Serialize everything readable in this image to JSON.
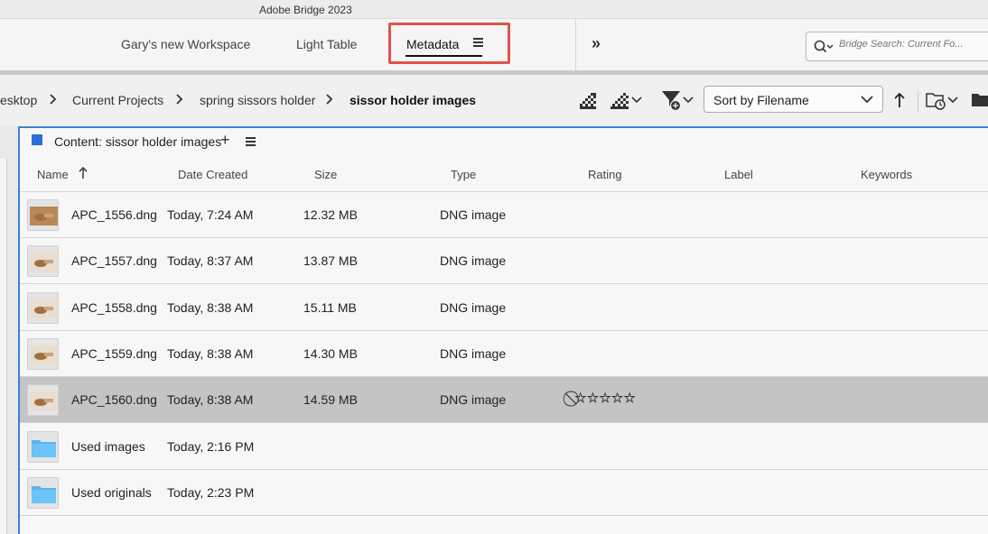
{
  "app": {
    "title": "Adobe Bridge 2023"
  },
  "workspace": {
    "tabs": [
      {
        "label": "Gary's new Workspace"
      },
      {
        "label": "Light Table"
      },
      {
        "label": "Metadata"
      }
    ],
    "more_label": "»",
    "search_placeholder": "Bridge Search: Current Fo..."
  },
  "path": {
    "crumbs": [
      "esktop",
      "Current Projects",
      "spring sissors holder",
      "sissor holder images"
    ],
    "sort_label": "Sort by Filename"
  },
  "content": {
    "title": "Content: sissor holder images",
    "columns": [
      "Name",
      "Date Created",
      "Size",
      "Type",
      "Rating",
      "Label",
      "Keywords"
    ],
    "rows": [
      {
        "name": "APC_1556.dng",
        "date": "Today, 7:24 AM",
        "size": "12.32 MB",
        "type": "DNG image",
        "thumb": "image"
      },
      {
        "name": "APC_1557.dng",
        "date": "Today, 8:37 AM",
        "size": "13.87 MB",
        "type": "DNG image",
        "thumb": "image"
      },
      {
        "name": "APC_1558.dng",
        "date": "Today, 8:38 AM",
        "size": "15.11 MB",
        "type": "DNG image",
        "thumb": "image"
      },
      {
        "name": "APC_1559.dng",
        "date": "Today, 8:38 AM",
        "size": "14.30 MB",
        "type": "DNG image",
        "thumb": "image"
      },
      {
        "name": "APC_1560.dng",
        "date": "Today, 8:38 AM",
        "size": "14.59 MB",
        "type": "DNG image",
        "thumb": "image",
        "rating": "⃠☆☆☆☆☆",
        "selected": true
      },
      {
        "name": "Used images",
        "date": "Today, 2:16 PM",
        "size": "",
        "type": "",
        "thumb": "folder"
      },
      {
        "name": "Used originals",
        "date": "Today, 2:23 PM",
        "size": "",
        "type": "",
        "thumb": "folder"
      }
    ]
  },
  "colors": {
    "accent": "#3d7fd6",
    "highlight": "#e0524a",
    "selected_row": "#c4c4c4",
    "folder": "#5bb4f0"
  }
}
